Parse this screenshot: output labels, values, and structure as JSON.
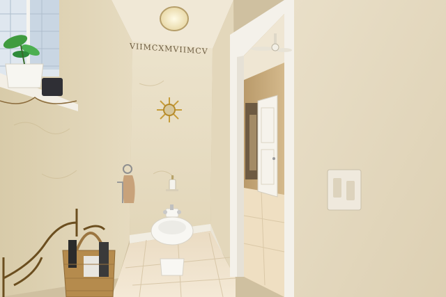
{
  "scene": {
    "wall_frieze_text": "VIIMCXMVIIMCV",
    "colors": {
      "wall_texture": "#e7dcc3",
      "wall_shadow": "#d2c3a0",
      "ceiling": "#f1ead9",
      "door_trim": "#f3f0ea",
      "floor_tile": "#efe3cf",
      "hallway_wall": "#c9a978",
      "plant_green": "#3f9b3f",
      "basket": "#b58b4d",
      "switch_plate": "#ebe4d8"
    },
    "icons": [
      "ceiling-light",
      "sunburst-mirror",
      "towel-ring",
      "soap-dispenser",
      "bidet",
      "ceiling-fan",
      "light-switch",
      "wicker-basket",
      "potted-plant"
    ]
  }
}
